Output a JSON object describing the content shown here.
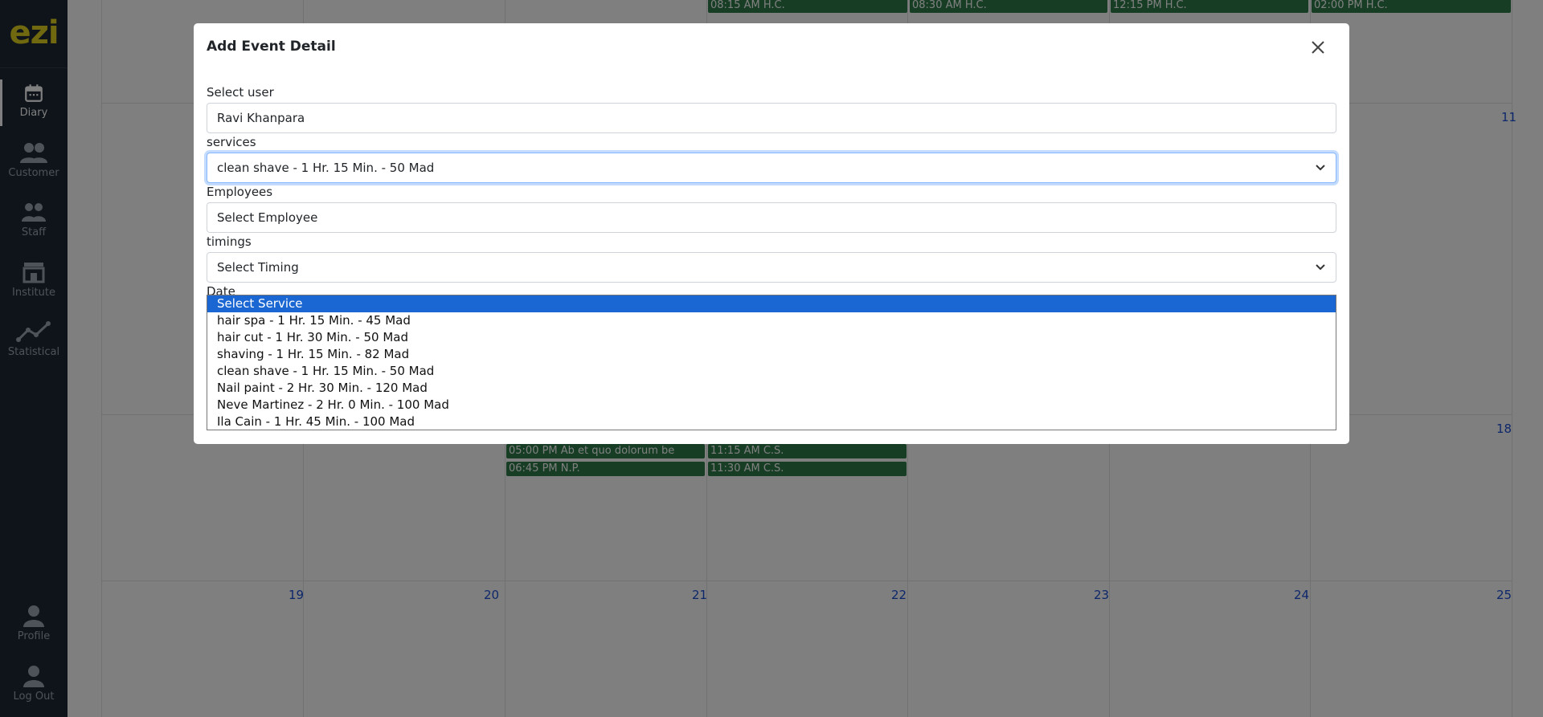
{
  "sidebar": {
    "logo": "ezi",
    "items": [
      {
        "label": "Diary",
        "icon": "calendar-icon"
      },
      {
        "label": "Customer",
        "icon": "users-icon"
      },
      {
        "label": "Staff",
        "icon": "staff-icon"
      },
      {
        "label": "Institute",
        "icon": "store-icon"
      },
      {
        "label": "Statistical",
        "icon": "chart-line-icon"
      }
    ],
    "bottom": [
      {
        "label": "Profile",
        "icon": "user-icon"
      },
      {
        "label": "Log Out",
        "icon": "logout-user-icon"
      }
    ]
  },
  "calendar": {
    "day_numbers": {
      "d11": "11",
      "d18": "18",
      "d19": "19",
      "d20": "20",
      "d21": "21",
      "d22": "22",
      "d23": "23",
      "d24": "24",
      "d25": "25"
    },
    "events": {
      "e1": "08:15 AM H.C.",
      "e2": "08:30 AM H.C.",
      "e3": "12:15 PM H.C.",
      "e4": "02:00 PM H.C.",
      "e5": "05:00 PM Ab et quo dolorum be",
      "e6": "06:45 PM N.P.",
      "e7": "11:15 AM C.S.",
      "e8": "11:30 AM C.S."
    }
  },
  "modal": {
    "title": "Add Event Detail",
    "fields": {
      "user": {
        "label": "Select user",
        "value": "Ravi Khanpara"
      },
      "services": {
        "label": "services",
        "value": "clean shave - 1 Hr. 15 Min. - 50 Mad"
      },
      "employees": {
        "label": "Employees",
        "placeholder": "Select Employee"
      },
      "timings": {
        "label": "timings",
        "value": "Select Timing"
      },
      "date": {
        "label": "Date"
      }
    },
    "service_options": [
      "Select Service",
      "hair spa - 1 Hr. 15 Min. - 45 Mad",
      "hair cut - 1 Hr. 30 Min. - 50 Mad",
      "shaving - 1 Hr. 15 Min. - 82 Mad",
      "clean shave - 1 Hr. 15 Min. - 50 Mad",
      "Nail paint - 2 Hr. 30 Min. - 120 Mad",
      "Neve Martinez - 2 Hr. 0 Min. - 100 Mad",
      "Ila Cain - 1 Hr. 45 Min. - 100 Mad"
    ]
  }
}
